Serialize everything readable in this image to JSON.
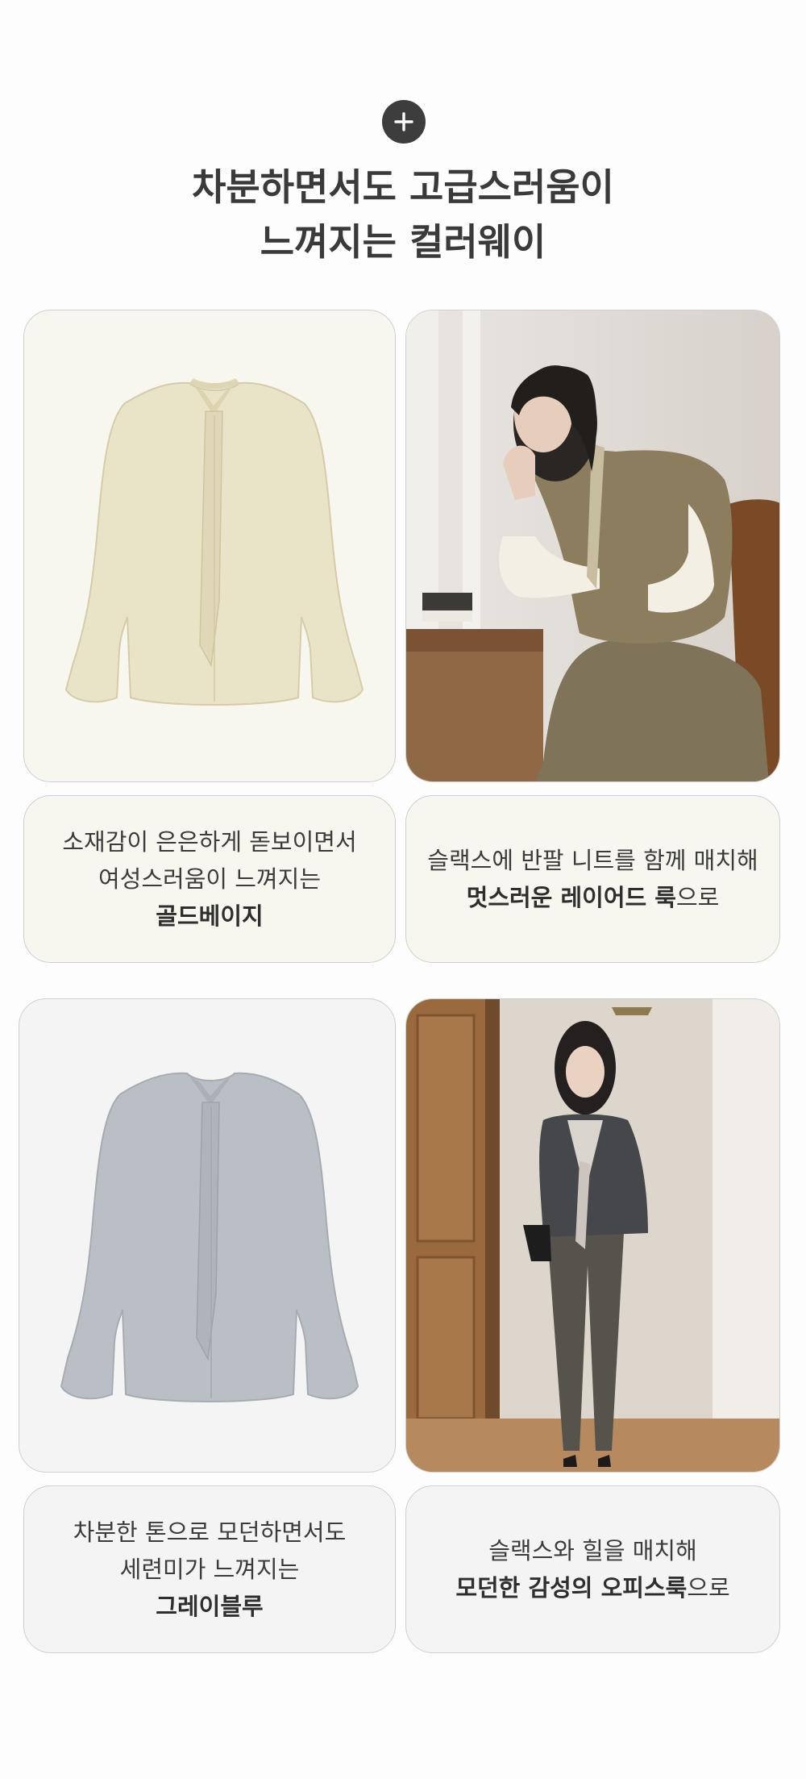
{
  "header": {
    "icon": "plus-icon",
    "title_line1": "차분하면서도 고급스러움이",
    "title_line2": "느껴지는 컬러웨이"
  },
  "sections": [
    {
      "color_name": "골드베이지",
      "product_caption": {
        "line1": "소재감이 은은하게 돋보이면서",
        "line2": "여성스러움이 느껴지는",
        "highlight": "골드베이지"
      },
      "style_caption": {
        "line1": "슬랙스에 반팔 니트를 함께 매치해",
        "highlight": "멋스러운 레이어드 룩",
        "suffix": "으로"
      },
      "colors": {
        "card_bg": "#f8f7ef",
        "blouse": "#e9e3c8"
      }
    },
    {
      "color_name": "그레이블루",
      "product_caption": {
        "line1": "차분한 톤으로 모던하면서도",
        "line2": "세련미가 느껴지는",
        "highlight": "그레이블루"
      },
      "style_caption": {
        "line1": "슬랙스와 힐을 매치해",
        "highlight": "모던한 감성의 오피스룩",
        "suffix": "으로"
      },
      "colors": {
        "card_bg": "#f4f4f4",
        "blouse": "#b9bfc4"
      }
    }
  ]
}
